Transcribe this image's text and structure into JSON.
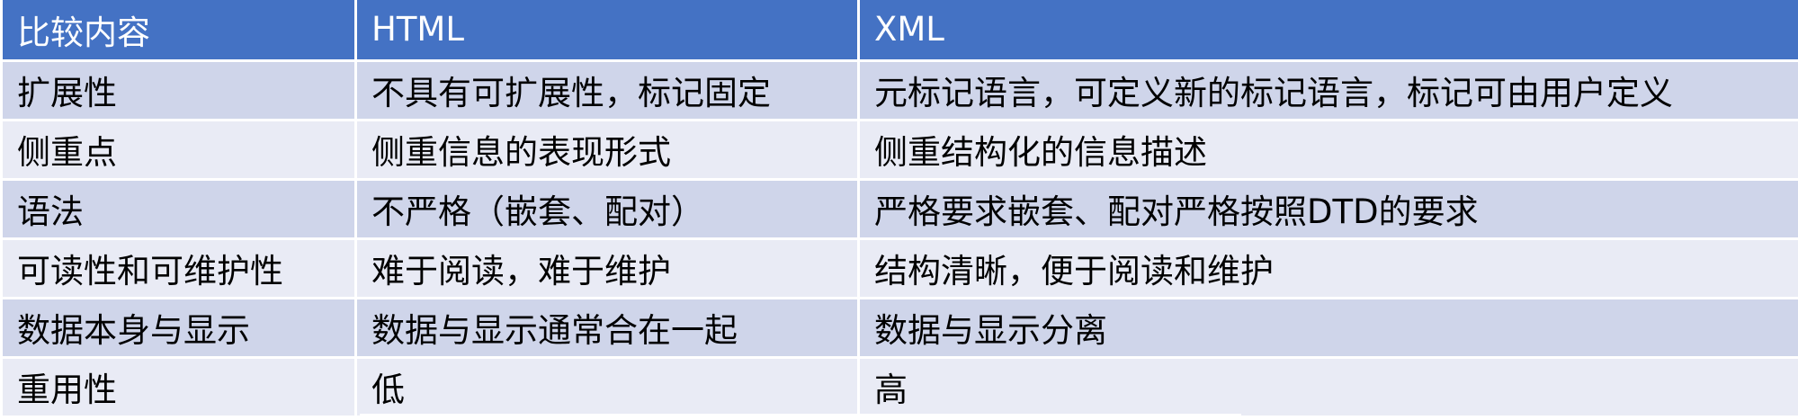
{
  "table": {
    "headers": [
      "比较内容",
      "HTML",
      "XML"
    ],
    "rows": [
      [
        "扩展性",
        "不具有可扩展性，标记固定",
        "元标记语言，可定义新的标记语言，标记可由用户定义"
      ],
      [
        "侧重点",
        "侧重信息的表现形式",
        "侧重结构化的信息描述"
      ],
      [
        "语法",
        "不严格（嵌套、配对）",
        "严格要求嵌套、配对严格按照DTD的要求"
      ],
      [
        "可读性和可维护性",
        "难于阅读，难于维护",
        "结构清晰，便于阅读和维护"
      ],
      [
        "数据本身与显示",
        "数据与显示通常合在一起",
        "数据与显示分离"
      ],
      [
        "重用性",
        "低",
        "高"
      ]
    ]
  },
  "colors": {
    "header_bg": "#4472c4",
    "row_odd_bg": "#cfd5ea",
    "row_even_bg": "#e9ebf5",
    "border": "#ffffff"
  }
}
